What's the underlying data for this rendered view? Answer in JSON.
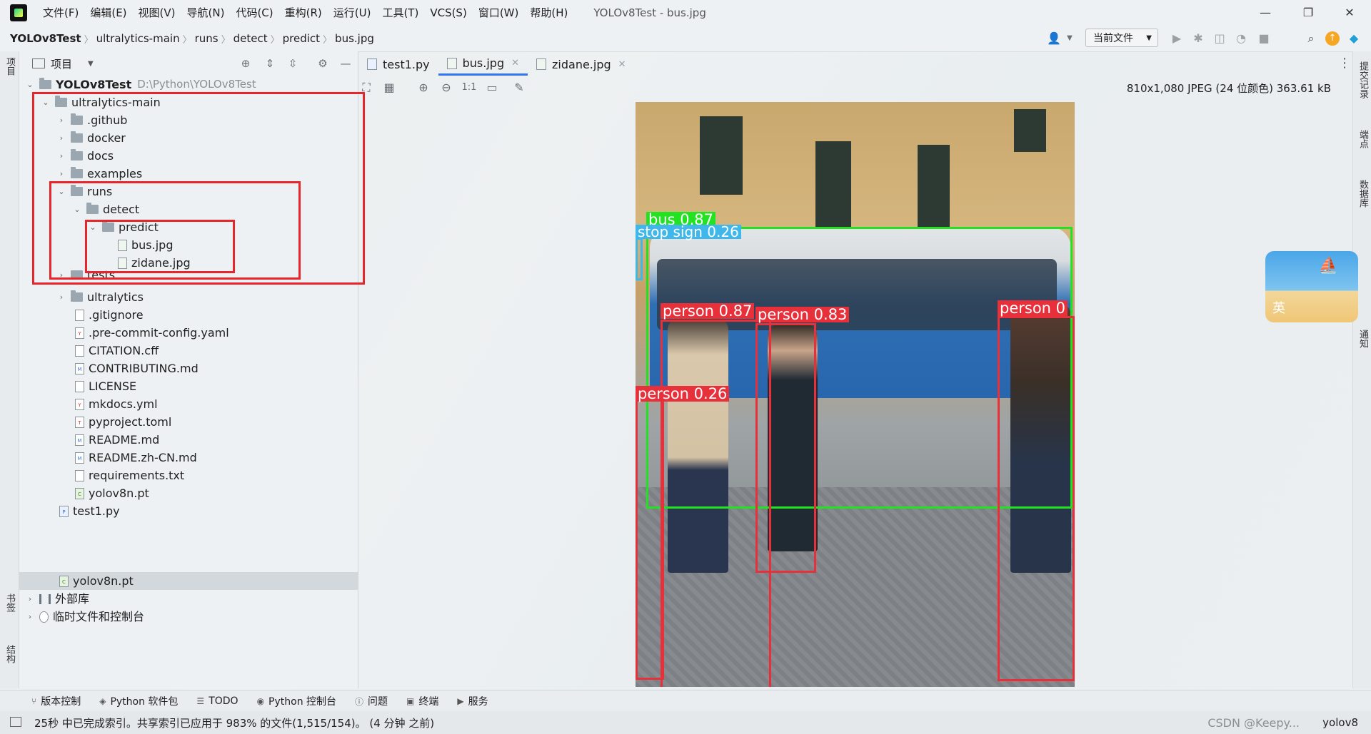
{
  "menu": [
    "文件(F)",
    "编辑(E)",
    "视图(V)",
    "导航(N)",
    "代码(C)",
    "重构(R)",
    "运行(U)",
    "工具(T)",
    "VCS(S)",
    "窗口(W)",
    "帮助(H)"
  ],
  "window_title": "YOLOv8Test - bus.jpg",
  "breadcrumbs": [
    "YOLOv8Test",
    "ultralytics-main",
    "runs",
    "detect",
    "predict",
    "bus.jpg"
  ],
  "file_scope": "当前文件",
  "left_stripe": {
    "project": "项目",
    "bookmarks": "书签",
    "structure": "结构"
  },
  "project_panel": {
    "title": "项目"
  },
  "tree": [
    {
      "label": "YOLOv8Test",
      "sub": "D:\\Python\\YOLOv8Test",
      "arrow": "⌄",
      "icon": "folder-icon",
      "bold": true
    },
    {
      "label": "ultralytics-main",
      "arrow": "⌄",
      "icon": "folder-icon"
    },
    {
      "label": ".github",
      "arrow": "›",
      "icon": "folder-icon"
    },
    {
      "label": "docker",
      "arrow": "›",
      "icon": "folder-icon"
    },
    {
      "label": "docs",
      "arrow": "›",
      "icon": "folder-icon"
    },
    {
      "label": "examples",
      "arrow": "›",
      "icon": "folder-icon"
    },
    {
      "label": "runs",
      "arrow": "⌄",
      "icon": "folder-icon"
    },
    {
      "label": "detect",
      "arrow": "⌄",
      "icon": "folder-icon"
    },
    {
      "label": "predict",
      "arrow": "⌄",
      "icon": "folder-icon"
    },
    {
      "label": "bus.jpg",
      "arrow": "",
      "icon": "image-file-icon"
    },
    {
      "label": "zidane.jpg",
      "arrow": "",
      "icon": "image-file-icon"
    },
    {
      "label": "tests",
      "arrow": "›",
      "icon": "folder-icon"
    },
    {
      "label": "ultralytics",
      "arrow": "›",
      "icon": "folder-icon"
    },
    {
      "label": ".gitignore",
      "arrow": "",
      "icon": "gitignore-file-icon"
    },
    {
      "label": ".pre-commit-config.yaml",
      "arrow": "",
      "icon": "yaml-file-icon"
    },
    {
      "label": "CITATION.cff",
      "arrow": "",
      "icon": "text-file-icon"
    },
    {
      "label": "CONTRIBUTING.md",
      "arrow": "",
      "icon": "markdown-file-icon"
    },
    {
      "label": "LICENSE",
      "arrow": "",
      "icon": "text-file-icon"
    },
    {
      "label": "mkdocs.yml",
      "arrow": "",
      "icon": "yaml-file-icon"
    },
    {
      "label": "pyproject.toml",
      "arrow": "",
      "icon": "toml-file-icon"
    },
    {
      "label": "README.md",
      "arrow": "",
      "icon": "markdown-file-icon"
    },
    {
      "label": "README.zh-CN.md",
      "arrow": "",
      "icon": "markdown-file-icon"
    },
    {
      "label": "requirements.txt",
      "arrow": "",
      "icon": "text-file-icon"
    },
    {
      "label": "yolov8n.pt",
      "arrow": "",
      "icon": "model-file-icon"
    },
    {
      "label": "test1.py",
      "arrow": "",
      "icon": "python-file-icon"
    },
    {
      "label": "yolov8n.pt",
      "arrow": "",
      "icon": "model-file-icon"
    },
    {
      "label": "外部库",
      "arrow": "›",
      "icon": "library-icon"
    },
    {
      "label": "临时文件和控制台",
      "arrow": "›",
      "icon": "scratches-icon"
    }
  ],
  "tabs": [
    {
      "label": "test1.py",
      "active": false
    },
    {
      "label": "bus.jpg",
      "active": true
    },
    {
      "label": "zidane.jpg",
      "active": false
    }
  ],
  "image_info": "810x1,080 JPEG (24 位颜色) 363.61 kB",
  "image_toolbar": {
    "actual_size": "1:1"
  },
  "detections": [
    {
      "label": "bus 0.87",
      "color": "#22e222"
    },
    {
      "label": "stop sign 0.26",
      "color": "#3fb7ea"
    },
    {
      "label": "person 0.87",
      "color": "#e8303a"
    },
    {
      "label": "person 0.83",
      "color": "#e8303a"
    },
    {
      "label": "person 0.26",
      "color": "#e8303a"
    },
    {
      "label": "person 0",
      "color": "#e8303a"
    }
  ],
  "right_stripe": {
    "commit": "提交记录",
    "endpoints": "端点",
    "database": "数据库",
    "notifications": "通知"
  },
  "ime": {
    "label": "英"
  },
  "bottom_tools": [
    {
      "label": "版本控制",
      "icon": "vcs-icon"
    },
    {
      "label": "Python 软件包",
      "icon": "packages-icon"
    },
    {
      "label": "TODO",
      "icon": "todo-icon"
    },
    {
      "label": "Python 控制台",
      "icon": "python-console-icon"
    },
    {
      "label": "问题",
      "icon": "problems-icon"
    },
    {
      "label": "终端",
      "icon": "terminal-icon"
    },
    {
      "label": "服务",
      "icon": "services-icon"
    }
  ],
  "status": {
    "text": "25秒 中已完成索引。共享索引已应用于 983% 的文件(1,515/154)。 (4 分钟 之前)",
    "interpreter": "yolov8",
    "watermark": "CSDN @Keepy..."
  },
  "colors": {
    "accent": "#3574f0",
    "highlight_box": "#e8252a"
  }
}
